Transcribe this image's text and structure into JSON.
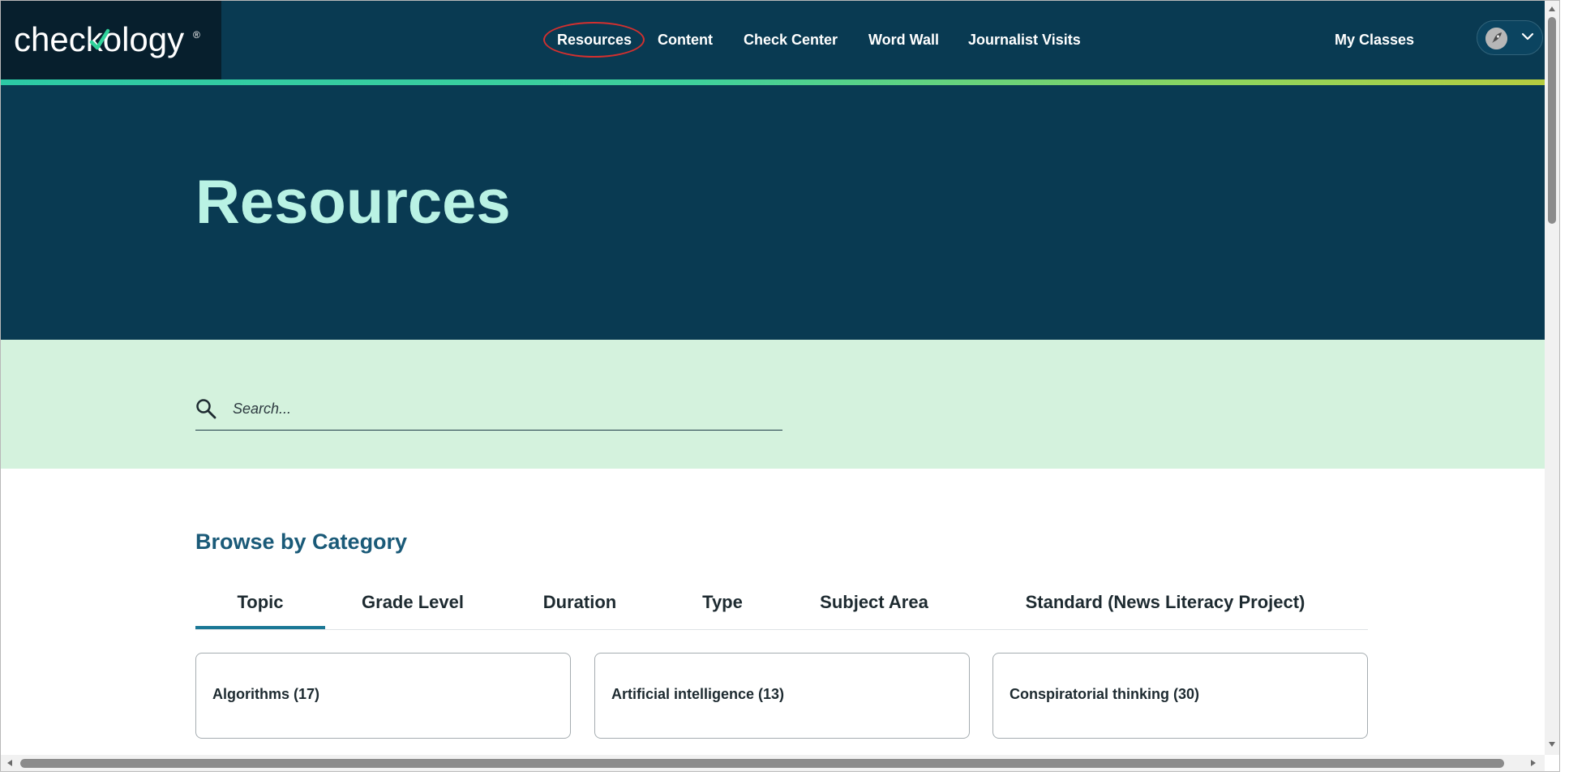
{
  "brand": {
    "logo_text": "checkology",
    "reg_mark": "®"
  },
  "nav": {
    "links": [
      {
        "label": "Resources",
        "active": true
      },
      {
        "label": "Content"
      },
      {
        "label": "Check Center"
      },
      {
        "label": "Word Wall"
      },
      {
        "label": "Journalist Visits"
      }
    ],
    "my_classes": "My Classes",
    "user_menu_icon": "rocket-icon"
  },
  "hero": {
    "title": "Resources"
  },
  "search": {
    "placeholder": "Search...",
    "icon": "search-icon"
  },
  "browse": {
    "heading": "Browse by Category",
    "tabs": [
      "Topic",
      "Grade Level",
      "Duration",
      "Type",
      "Subject Area",
      "Standard (News Literacy Project)"
    ],
    "active_tab": "Topic",
    "cards": [
      "Algorithms (17)",
      "Artificial intelligence (13)",
      "Conspiratorial thinking (30)"
    ]
  },
  "colors": {
    "nav_bg": "#093a52",
    "logo_bg": "#071f2d",
    "hero_title": "#b9f2e4",
    "search_band": "#d4f2dd",
    "heading": "#1a5a78",
    "tab_underline": "#1b7896",
    "highlight_ring": "#d3302f"
  }
}
